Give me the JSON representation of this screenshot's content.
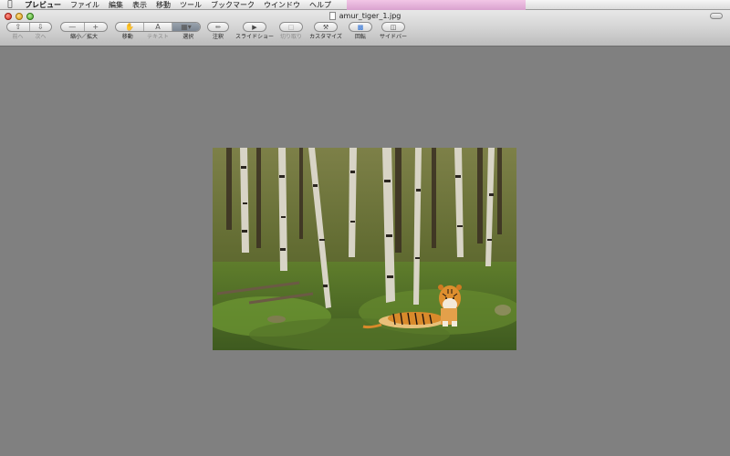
{
  "menubar": {
    "apple_icon": "apple-logo",
    "items": [
      "プレビュー",
      "ファイル",
      "編集",
      "表示",
      "移動",
      "ツール",
      "ブックマーク",
      "ウインドウ",
      "ヘルプ"
    ]
  },
  "window": {
    "title": "amur_tiger_1.jpg",
    "toolbar": {
      "nav": {
        "prev": "前へ",
        "next": "次へ"
      },
      "zoom": {
        "label": "縮小／拡大"
      },
      "tools": {
        "move": "移動",
        "text": "テキスト",
        "select": "選択"
      },
      "annotate": "注釈",
      "slideshow": "スライドショー",
      "crop": "切り取り",
      "customize": "カスタマイズ",
      "rotate": "回転",
      "sidebar": "サイドバー"
    }
  },
  "image": {
    "subject": "tiger lying in birch forest"
  }
}
